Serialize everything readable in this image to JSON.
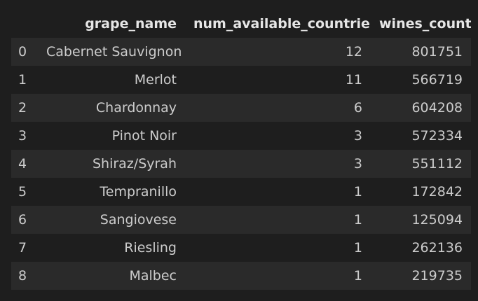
{
  "table": {
    "columns": [
      "",
      "grape_name",
      "num_available_countries",
      "wines_count"
    ],
    "rows": [
      {
        "index": "0",
        "grape_name": "Cabernet Sauvignon",
        "num_available_countries": "12",
        "wines_count": "801751"
      },
      {
        "index": "1",
        "grape_name": "Merlot",
        "num_available_countries": "11",
        "wines_count": "566719"
      },
      {
        "index": "2",
        "grape_name": "Chardonnay",
        "num_available_countries": "6",
        "wines_count": "604208"
      },
      {
        "index": "3",
        "grape_name": "Pinot Noir",
        "num_available_countries": "3",
        "wines_count": "572334"
      },
      {
        "index": "4",
        "grape_name": "Shiraz/Syrah",
        "num_available_countries": "3",
        "wines_count": "551112"
      },
      {
        "index": "5",
        "grape_name": "Tempranillo",
        "num_available_countries": "1",
        "wines_count": "172842"
      },
      {
        "index": "6",
        "grape_name": "Sangiovese",
        "num_available_countries": "1",
        "wines_count": "125094"
      },
      {
        "index": "7",
        "grape_name": "Riesling",
        "num_available_countries": "1",
        "wines_count": "262136"
      },
      {
        "index": "8",
        "grape_name": "Malbec",
        "num_available_countries": "1",
        "wines_count": "219735"
      }
    ]
  }
}
